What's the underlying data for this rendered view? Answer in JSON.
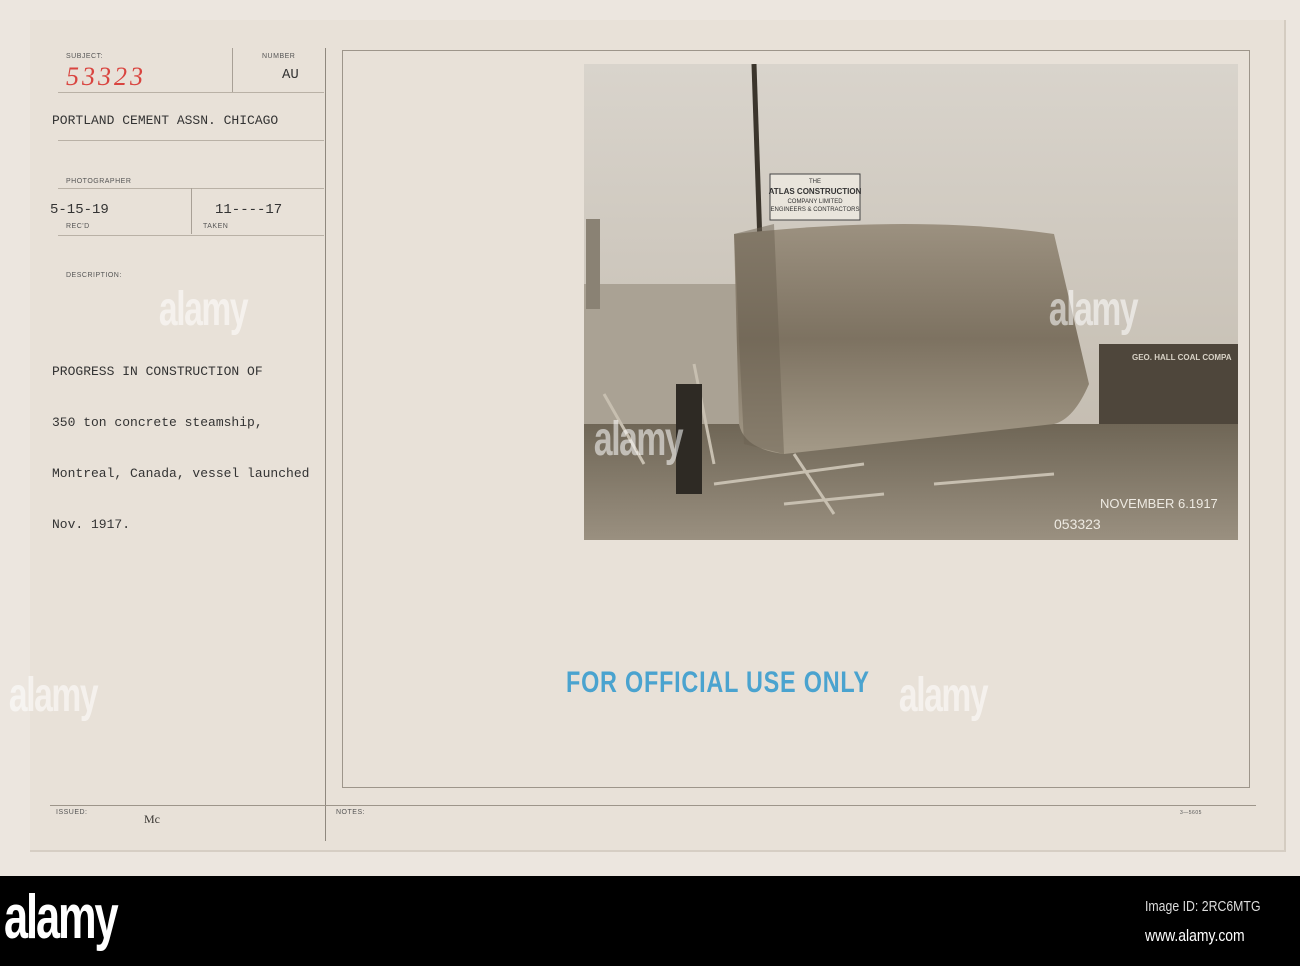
{
  "card": {
    "subject_label": "SUBJECT:",
    "subject_number": "53323",
    "number_label": "NUMBER",
    "number_value": "AU",
    "source": "PORTLAND CEMENT ASSN. CHICAGO",
    "photographer_label": "PHOTOGRAPHER",
    "received_date": "5-15-19",
    "received_label": "REC'D",
    "taken_date": "11----17",
    "taken_label": "TAKEN",
    "description_label": "DESCRIPTION:",
    "description_lines": [
      "PROGRESS IN CONSTRUCTION OF",
      "350 ton concrete steamship,",
      "Montreal, Canada, vessel launched",
      "Nov. 1917."
    ],
    "issued_label": "ISSUED:",
    "issued_value": "Mc",
    "notes_label": "NOTES:",
    "form_number": "3—5605",
    "stamp": "FOR OFFICIAL USE ONLY"
  },
  "photo": {
    "sign_text": [
      "THE",
      "ATLAS CONSTRUCTION",
      "COMPANY LIMITED",
      "ENGINEERS & CONTRACTORS"
    ],
    "building_sign": "GEO. HALL COAL COMPA",
    "caption_date": "NOVEMBER 6.1917",
    "caption_number": "053323"
  },
  "watermark": "alamy",
  "footer": {
    "logo": "alamy",
    "image_id": "Image ID: 2RC6MTG",
    "url": "www.alamy.com"
  }
}
